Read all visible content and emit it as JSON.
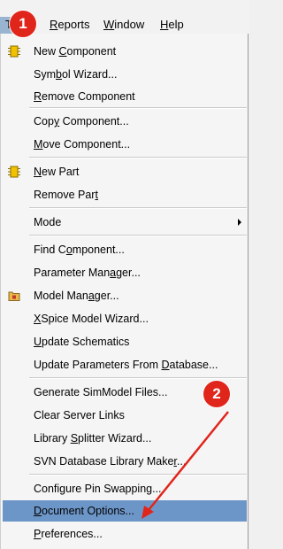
{
  "menubar": {
    "items": [
      {
        "label": "Reports",
        "ul": "R"
      },
      {
        "label": "Window",
        "ul": "W"
      },
      {
        "label": "Help",
        "ul": "H"
      }
    ],
    "active_label": "T"
  },
  "menu": {
    "items": [
      {
        "label_pre": "New ",
        "label_ul": "C",
        "label_post": "omponent",
        "icon": "chip-icon"
      },
      {
        "label_pre": "Sym",
        "label_ul": "b",
        "label_post": "ol Wizard..."
      },
      {
        "label_pre": "",
        "label_ul": "R",
        "label_post": "emove Component"
      },
      {
        "label_pre": "Cop",
        "label_ul": "y",
        "label_post": " Component..."
      },
      {
        "label_pre": "",
        "label_ul": "M",
        "label_post": "ove Component..."
      },
      {
        "label_pre": "",
        "label_ul": "N",
        "label_post": "ew Part",
        "icon": "chip-icon"
      },
      {
        "label_pre": "Remove Par",
        "label_ul": "t",
        "label_post": ""
      },
      {
        "label_pre": "Mode",
        "label_ul": "",
        "label_post": "",
        "submenu": true
      },
      {
        "label_pre": "Find C",
        "label_ul": "o",
        "label_post": "mponent..."
      },
      {
        "label_pre": "Parameter Man",
        "label_ul": "a",
        "label_post": "ger..."
      },
      {
        "label_pre": "Model Man",
        "label_ul": "a",
        "label_post": "ger...",
        "icon": "folder-icon"
      },
      {
        "label_pre": "",
        "label_ul": "X",
        "label_post": "Spice Model Wizard..."
      },
      {
        "label_pre": "",
        "label_ul": "U",
        "label_post": "pdate Schematics"
      },
      {
        "label_pre": "Update Parameters From ",
        "label_ul": "D",
        "label_post": "atabase..."
      },
      {
        "label_pre": "Generate SimModel Files...",
        "label_ul": "",
        "label_post": ""
      },
      {
        "label_pre": "Clear Server Links",
        "label_ul": "",
        "label_post": ""
      },
      {
        "label_pre": "Library ",
        "label_ul": "S",
        "label_post": "plitter Wizard..."
      },
      {
        "label_pre": "SVN Database Library Make",
        "label_ul": "r",
        "label_post": "..."
      },
      {
        "label_pre": "Configure Pin Swapping...",
        "label_ul": "",
        "label_post": ""
      },
      {
        "label_pre": "",
        "label_ul": "D",
        "label_post": "ocument Options...",
        "highlighted": true
      },
      {
        "label_pre": "",
        "label_ul": "P",
        "label_post": "references..."
      }
    ]
  },
  "annotations": {
    "badge1": "1",
    "badge2": "2",
    "colors": {
      "badge": "#e0251b",
      "arrow": "#e0251b",
      "highlight": "#6d96c8"
    }
  }
}
